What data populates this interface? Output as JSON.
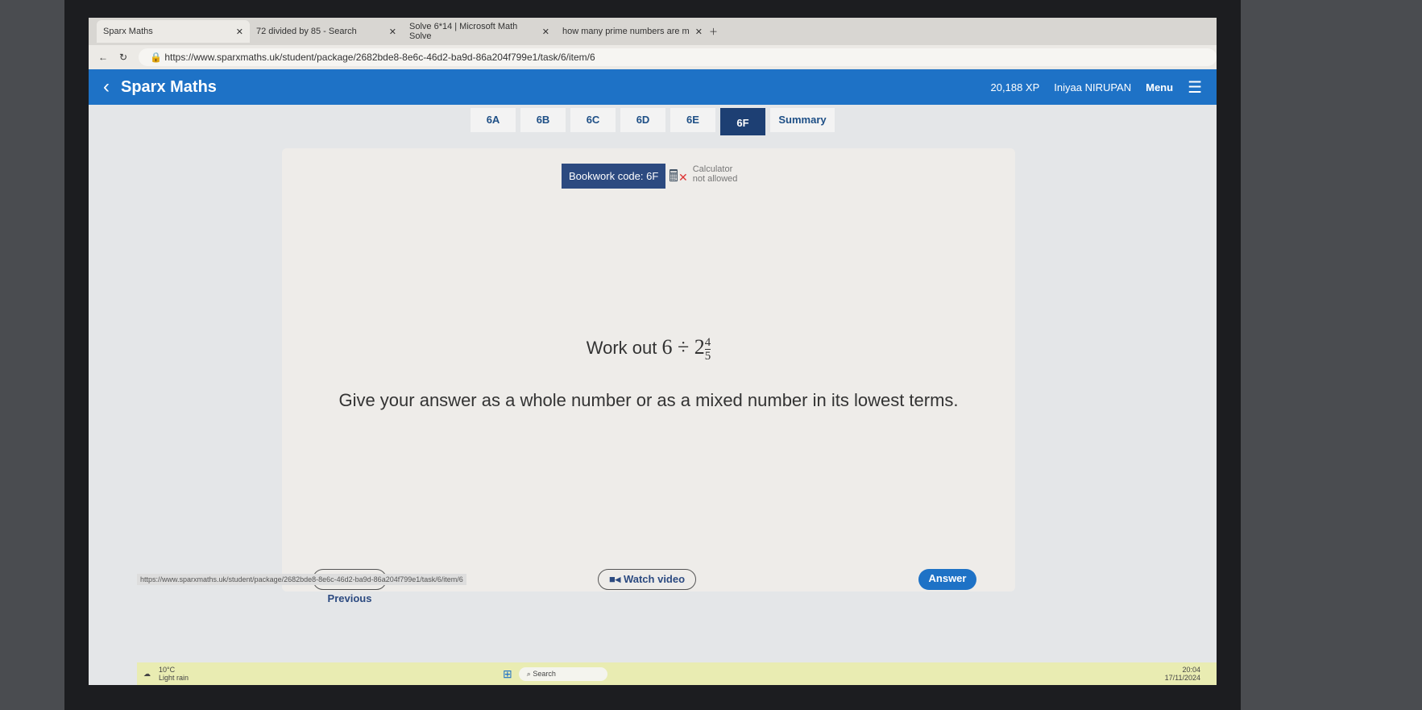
{
  "browser": {
    "tabs": [
      {
        "label": "Sparx Maths",
        "active": true
      },
      {
        "label": "72 divided by 85 - Search"
      },
      {
        "label": "Solve 6*14 | Microsoft Math Solve"
      },
      {
        "label": "how many prime numbers are m"
      }
    ],
    "url": "https://www.sparxmaths.uk/student/package/2682bde8-8e6c-46d2-ba9d-86a204f799e1/task/6/item/6"
  },
  "header": {
    "title": "Sparx Maths",
    "xp": "20,188 XP",
    "user": "Iniyaa NIRUPAN",
    "menu": "Menu"
  },
  "tasks": [
    "6A",
    "6B",
    "6C",
    "6D",
    "6E",
    "6F",
    "Summary"
  ],
  "question": {
    "bookwork": "Bookwork code: 6F",
    "calc1": "Calculator",
    "calc2": "not allowed",
    "prefix": "Work out",
    "expr": "6 ÷ 2",
    "num": "4",
    "den": "5",
    "instruction": "Give your answer as a whole number or as a mixed number in its lowest terms."
  },
  "buttons": {
    "previous": "< Previous",
    "video": "Watch video",
    "answer": "Answer"
  },
  "status_url": "https://www.sparxmaths.uk/student/package/2682bde8-8e6c-46d2-ba9d-86a204f799e1/task/6/item/6",
  "taskbar": {
    "temp": "10°C",
    "weather": "Light rain",
    "search": "Search",
    "time": "20:04",
    "date": "17/11/2024"
  }
}
